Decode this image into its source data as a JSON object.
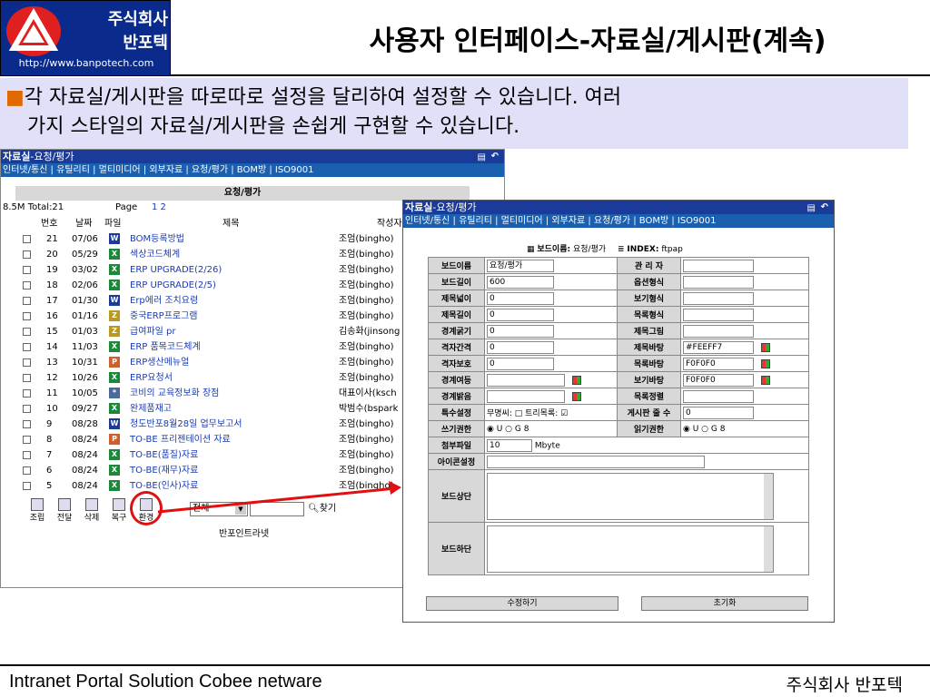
{
  "company": {
    "name_line1": "주식회사",
    "name_line2": "반포텍",
    "url": "http://www.banpotech.com"
  },
  "slide_title": "사용자 인터페이스-자료실/게시판(계속)",
  "intro": {
    "bullet": "■",
    "line1": "각 자료실/게시판을 따로따로 설정을 달리하여 설정할 수 있습니다. 여러",
    "line2": "가지 스타일의 자료실/게시판을 손쉽게 구현할 수 있습니다."
  },
  "left_window": {
    "title": "자료실",
    "subtitle": "-요청/평가",
    "menu": "인터넷/통신 | 유틸리티 | 멀티미디어 | 외부자료 | 요청/평가 | BOM방 | ISO9001",
    "board_name": "요청/평가",
    "total": "8.5M Total:21",
    "page_label": "Page",
    "page_links": "1 2",
    "columns": {
      "no": "번호",
      "date": "날짜",
      "file": "파일",
      "subject": "제목",
      "author": "작성자"
    },
    "rows": [
      {
        "no": "21",
        "date": "07/06",
        "icon": "W",
        "color": "#1a3b9a",
        "subject": "BOM등록방법",
        "author": "조엄(bingho)"
      },
      {
        "no": "20",
        "date": "05/29",
        "icon": "X",
        "color": "#1a8a3a",
        "subject": "색상코드체계",
        "author": "조엄(bingho)"
      },
      {
        "no": "19",
        "date": "03/02",
        "icon": "X",
        "color": "#1a8a3a",
        "subject": "ERP UPGRADE(2/26)",
        "author": "조엄(bingho)"
      },
      {
        "no": "18",
        "date": "02/06",
        "icon": "X",
        "color": "#1a8a3a",
        "subject": "ERP UPGRADE(2/5)",
        "author": "조엄(bingho)"
      },
      {
        "no": "17",
        "date": "01/30",
        "icon": "W",
        "color": "#1a3b9a",
        "subject": "Erp에러 조치요령",
        "author": "조엄(bingho)"
      },
      {
        "no": "16",
        "date": "01/16",
        "icon": "Z",
        "color": "#b89a20",
        "subject": "중국ERP프로그램",
        "author": "조엄(bingho)"
      },
      {
        "no": "15",
        "date": "01/03",
        "icon": "Z",
        "color": "#b89a20",
        "subject": "급여파일 pr",
        "author": "김송화(jinsong"
      },
      {
        "no": "14",
        "date": "11/03",
        "icon": "X",
        "color": "#1a8a3a",
        "subject": "ERP 품목코드체계",
        "author": "조엄(bingho)"
      },
      {
        "no": "13",
        "date": "10/31",
        "icon": "P",
        "color": "#d0602a",
        "subject": "ERP생산메뉴얼",
        "author": "조엄(bingho)"
      },
      {
        "no": "12",
        "date": "10/26",
        "icon": "X",
        "color": "#1a8a3a",
        "subject": "ERP요청서",
        "author": "조엄(bingho)"
      },
      {
        "no": "11",
        "date": "10/05",
        "icon": "*",
        "color": "#4a6a9a",
        "subject": "코비의 교육정보화 장점",
        "author": "대표이사(ksch"
      },
      {
        "no": "10",
        "date": "09/27",
        "icon": "X",
        "color": "#1a8a3a",
        "subject": "완제품재고",
        "author": "박범수(bspark"
      },
      {
        "no": "9",
        "date": "08/28",
        "icon": "W",
        "color": "#1a3b9a",
        "subject": "청도반포8월28일 업무보고서",
        "author": "조엄(bingho)"
      },
      {
        "no": "8",
        "date": "08/24",
        "icon": "P",
        "color": "#d0602a",
        "subject": "TO-BE 프리젠테이션 자료",
        "author": "조엄(bingho)"
      },
      {
        "no": "7",
        "date": "08/24",
        "icon": "X",
        "color": "#1a8a3a",
        "subject": "TO-BE(품질)자료",
        "author": "조엄(bingho)"
      },
      {
        "no": "6",
        "date": "08/24",
        "icon": "X",
        "color": "#1a8a3a",
        "subject": "TO-BE(재무)자료",
        "author": "조엄(bingho)"
      },
      {
        "no": "5",
        "date": "08/24",
        "icon": "X",
        "color": "#1a8a3a",
        "subject": "TO-BE(인사)자료",
        "author": "조엄(bingho)"
      }
    ],
    "toolbar": [
      {
        "label": "조립",
        "name": "compose-button"
      },
      {
        "label": "전달",
        "name": "forward-button"
      },
      {
        "label": "삭제",
        "name": "delete-button"
      },
      {
        "label": "복구",
        "name": "restore-button"
      },
      {
        "label": "환경",
        "name": "settings-button"
      }
    ],
    "search_scope": "전체",
    "search_button": "찾기",
    "footer_text": "반포인트라넷"
  },
  "right_window": {
    "title": "자료실",
    "subtitle": "-요청/평가",
    "menu": "인터넷/통신 | 유틸리티 | 멀티미디어 | 외부자료 | 요청/평가 | BOM방 | ISO9001",
    "board_name_label": "보드이름:",
    "board_name_value": "요청/평가",
    "index_label": "INDEX:",
    "index_value": "ftpap",
    "fields": [
      {
        "l1": "보드이름",
        "v1": "요청/평가",
        "l2": "관 리 자",
        "v2": "",
        "p1": false,
        "p2": false
      },
      {
        "l1": "보드길이",
        "v1": "600",
        "l2": "옵션형식",
        "v2": "",
        "p1": false,
        "p2": false
      },
      {
        "l1": "제목넓이",
        "v1": "0",
        "l2": "보기형식",
        "v2": "",
        "p1": false,
        "p2": false
      },
      {
        "l1": "제목길이",
        "v1": "0",
        "l2": "목록형식",
        "v2": "",
        "p1": false,
        "p2": false
      },
      {
        "l1": "경계굵기",
        "v1": "0",
        "l2": "제목그림",
        "v2": "",
        "p1": false,
        "p2": false
      },
      {
        "l1": "격자간격",
        "v1": "0",
        "l2": "제목바탕",
        "v2": "#FEEFF7",
        "p1": false,
        "p2": true
      },
      {
        "l1": "격자보호",
        "v1": "0",
        "l2": "목록바탕",
        "v2": "F0F0F0",
        "p1": false,
        "p2": true
      },
      {
        "l1": "경계여등",
        "v1": "",
        "l2": "보기바탕",
        "v2": "F0F0F0",
        "p1": true,
        "p2": true
      },
      {
        "l1": "경계밝음",
        "v1": "",
        "l2": "목록정렬",
        "v2": "",
        "p1": true,
        "p2": false
      }
    ],
    "special_label": "특수설정",
    "special_text": "무명씨: □ 트리목록: ☑",
    "posts_label": "게시판 줄 수",
    "posts_value": "0",
    "write_label": "쓰기권한",
    "write_value": "◉ U ○ G 8",
    "read_label": "읽기권한",
    "read_value": "◉ U ○ G 8",
    "attach_label": "첨부파일",
    "attach_value": "10",
    "attach_unit": "Mbyte",
    "icon_label": "아이콘설정",
    "top_label": "보드상단",
    "bottom_label": "보드하단",
    "save_button": "수정하기",
    "reset_button": "초기화"
  },
  "footer": {
    "left": "Intranet Portal Solution Cobee netware",
    "right": "주식회사 반포텍"
  },
  "accent_colors": {
    "title_bar": "#1a3b9a",
    "menu_bar": "#1a5fb0",
    "highlight_circle": "#e01010",
    "arrow": "#e01010",
    "intro_bg": "#e0e0f8"
  }
}
